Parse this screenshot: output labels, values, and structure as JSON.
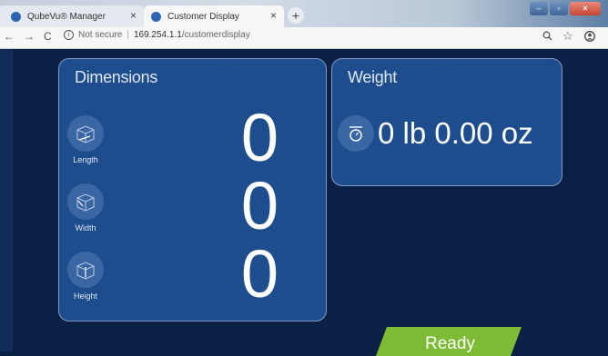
{
  "browser": {
    "tabs": [
      {
        "label": "QubeVu® Manager",
        "close": "×"
      },
      {
        "label": "Customer Display",
        "close": "×"
      }
    ],
    "new_tab": "+",
    "nav": {
      "back": "←",
      "forward": "→",
      "reload": "C"
    },
    "address": {
      "security_icon": "i",
      "security_text": "Not secure",
      "separator": "|",
      "host": "169.254.1.1",
      "path": "/customerdisplay"
    },
    "toolbar_icons": [
      "zoom-icon",
      "star-icon",
      "account-icon"
    ],
    "window_controls": [
      "minimize",
      "maximize",
      "close"
    ]
  },
  "dimensions": {
    "title": "Dimensions",
    "rows": [
      {
        "label": "Length",
        "value": "0",
        "icon": "length-box-icon"
      },
      {
        "label": "Width",
        "value": "0",
        "icon": "width-box-icon"
      },
      {
        "label": "Height",
        "value": "0",
        "icon": "height-box-icon"
      }
    ]
  },
  "weight": {
    "title": "Weight",
    "value": "0 lb 0.00 oz",
    "icon": "scale-icon"
  },
  "status": {
    "label": "Ready",
    "color": "#7dbb34"
  },
  "colors": {
    "background": "#0a2145",
    "panel": "#1e4d8e",
    "panel_border": "#7d9cc8",
    "icon_circle": "#3a66a3",
    "text": "#ffffff"
  }
}
